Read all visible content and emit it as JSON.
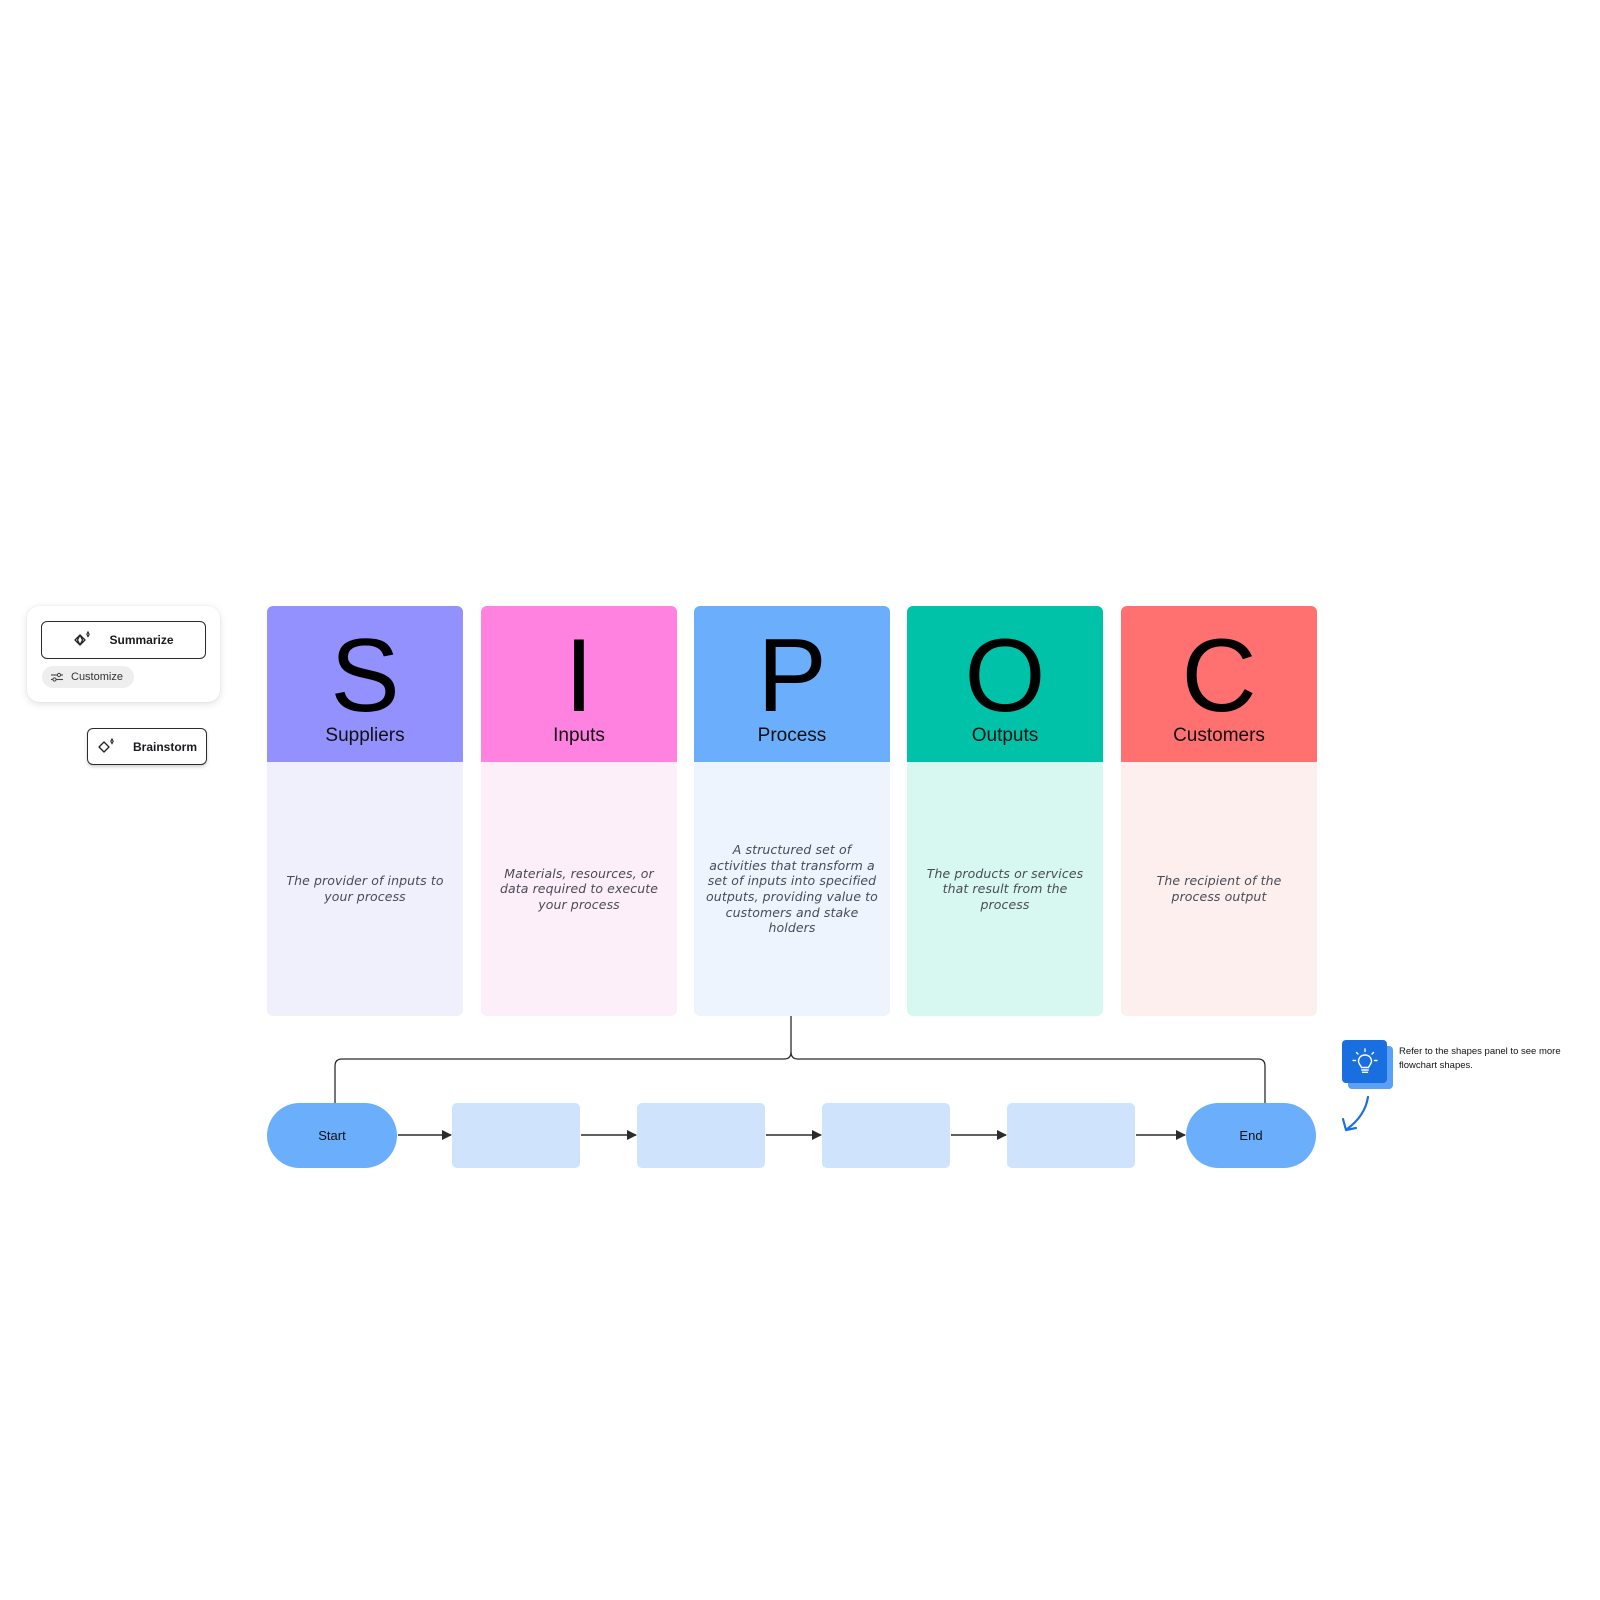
{
  "ai_tools": {
    "summarize_label": "Summarize",
    "customize_label": "Customize",
    "brainstorm_label": "Brainstorm",
    "icons": {
      "summarize": "sparkle-icon",
      "customize": "sliders-icon",
      "brainstorm": "sparkle-icon"
    }
  },
  "sipoc": {
    "columns": [
      {
        "letter": "S",
        "label": "Suppliers",
        "description": "The provider of inputs to your process",
        "header_color": "#9391fd",
        "body_color": "#f0f0fc"
      },
      {
        "letter": "I",
        "label": "Inputs",
        "description": "Materials, resources, or data required to execute your process",
        "header_color": "#ff81e0",
        "body_color": "#fdeff9"
      },
      {
        "letter": "P",
        "label": "Process",
        "description": "A structured set of activities that transform a set of inputs into specified outputs, providing value to customers and stake holders",
        "header_color": "#6aaefc",
        "body_color": "#edf4fd"
      },
      {
        "letter": "O",
        "label": "Outputs",
        "description": "The products or services that result from the process",
        "header_color": "#00c2a8",
        "body_color": "#d6f8f1"
      },
      {
        "letter": "C",
        "label": "Customers",
        "description": "The recipient of the process output",
        "header_color": "#ff7070",
        "body_color": "#fcefed"
      }
    ]
  },
  "flow": {
    "start_label": "Start",
    "end_label": "End",
    "steps": [
      "",
      "",
      "",
      ""
    ],
    "terminal_color": "#6aaefc",
    "step_color": "#cfe3fd"
  },
  "tip": {
    "icon": "lightbulb-icon",
    "text": "Refer to the shapes panel to see more flowchart shapes.",
    "accent": "#1a6fe0"
  }
}
